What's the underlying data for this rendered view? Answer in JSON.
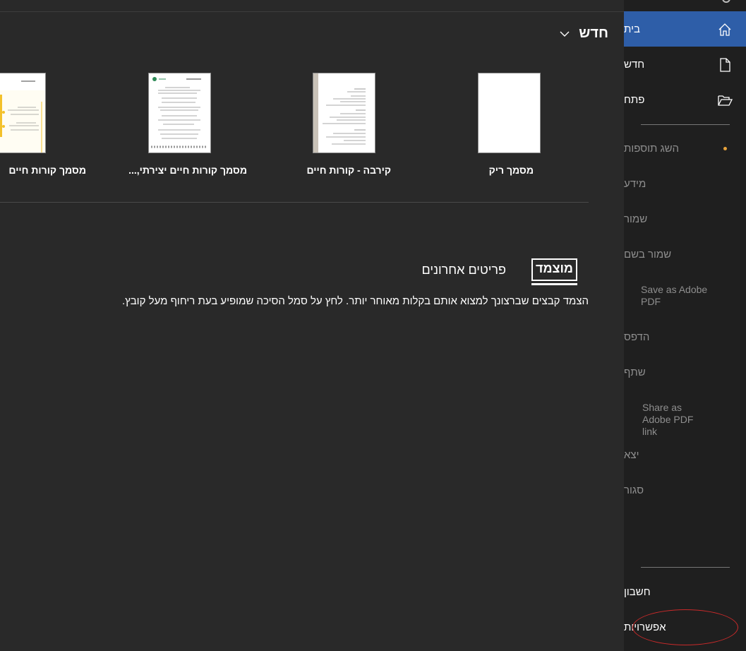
{
  "nav": {
    "home": "בית",
    "new": "חדש",
    "open": "פתח",
    "addins": "השג תוספות",
    "info": "מידע",
    "save": "שמור",
    "save_as": "שמור בשם",
    "save_adobe": "Save as Adobe PDF",
    "print": "הדפס",
    "share": "שתף",
    "share_adobe": "Share as Adobe PDF link",
    "export": "יצא",
    "close": "סגור",
    "account": "חשבון",
    "options": "אפשרויות"
  },
  "main": {
    "new_section_title": "חדש",
    "templates": [
      {
        "label": "מסמך ריק"
      },
      {
        "label": "קירבה - קורות חיים"
      },
      {
        "label": "מסמך קורות חיים יצירתי,..."
      },
      {
        "label": "מסמך קורות חיים"
      }
    ],
    "tabs": [
      {
        "label": "מוצמד",
        "selected": true
      },
      {
        "label": "פריטים אחרונים",
        "selected": false
      }
    ],
    "pinned_description": "הצמד קבצים שברצונך למצוא אותם בקלות מאוחר יותר. לחץ על סמל הסיכה שמופיע בעת ריחוף מעל קובץ."
  },
  "colors": {
    "active_nav": "#2e5ea8",
    "addin_dot": "#e8a33b",
    "highlight_ring": "#c92a2a"
  }
}
